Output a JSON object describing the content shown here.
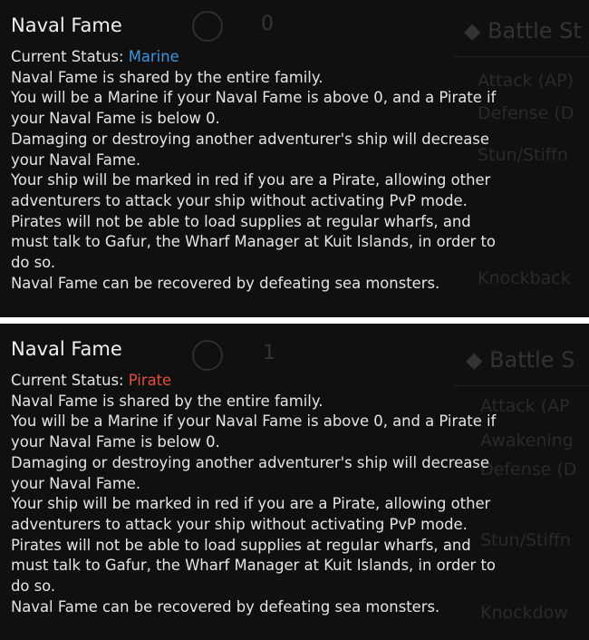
{
  "panels": [
    {
      "background": {
        "section_header": "Battle St",
        "counter": "0",
        "stats": [
          "Attack (AP)",
          "Defense (D",
          "Stun/Stiffn",
          "Knockback"
        ]
      },
      "tooltip": {
        "title": "Naval Fame",
        "status_label": "Current Status:",
        "status_value": "Marine",
        "status_color": "#3d95e0",
        "lines": [
          "Naval Fame is shared by the entire family.",
          "You will be a Marine if your Naval Fame is above 0, and a Pirate if",
          "your Naval Fame is below 0.",
          "Damaging or destroying another adventurer's ship will decrease",
          "your Naval Fame.",
          "Your ship will be marked in red if you are a Pirate, allowing other",
          "adventurers to attack your ship without activating PvP mode.",
          "Pirates will not be able to load supplies at regular wharfs, and",
          "must talk to Gafur, the Wharf Manager at Kuit Islands, in order to",
          "do so.",
          "Naval Fame can be recovered by defeating sea monsters."
        ]
      }
    },
    {
      "background": {
        "section_header": "Battle S",
        "counter": "1",
        "stats": [
          "Attack (AP",
          "Awakening",
          "Defense (D",
          "Stun/Stiffn",
          "Knockdow"
        ]
      },
      "tooltip": {
        "title": "Naval Fame",
        "status_label": "Current Status:",
        "status_value": "Pirate",
        "status_color": "#e0503a",
        "lines": [
          "Naval Fame is shared by the entire family.",
          "You will be a Marine if your Naval Fame is above 0, and a Pirate if",
          "your Naval Fame is below 0.",
          "Damaging or destroying another adventurer's ship will decrease",
          "your Naval Fame.",
          "Your ship will be marked in red if you are a Pirate, allowing other",
          "adventurers to attack your ship without activating PvP mode.",
          "Pirates will not be able to load supplies at regular wharfs, and",
          "must talk to Gafur, the Wharf Manager at Kuit Islands, in order to",
          "do so.",
          "Naval Fame can be recovered by defeating sea monsters."
        ]
      }
    }
  ]
}
